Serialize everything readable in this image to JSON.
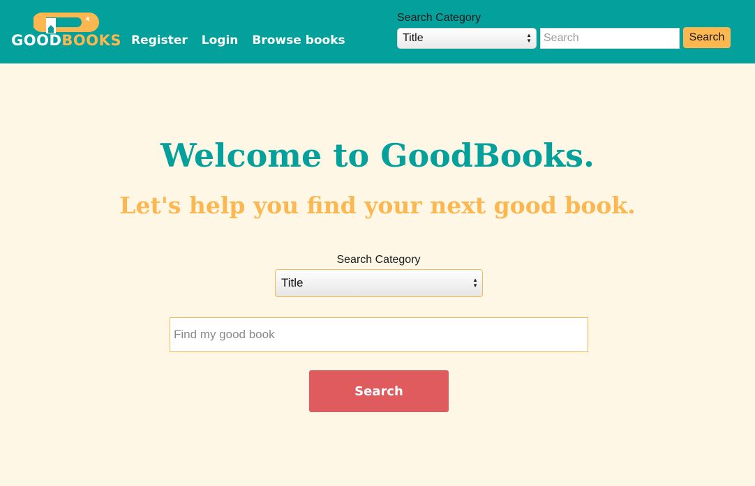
{
  "header": {
    "logo": {
      "word1": "GOOD",
      "word2": "BOOKS"
    },
    "nav": [
      {
        "label": "Register"
      },
      {
        "label": "Login"
      },
      {
        "label": "Browse books"
      }
    ],
    "search": {
      "label": "Search Category",
      "category_value": "Title",
      "placeholder": "Search",
      "button_label": "Search"
    }
  },
  "hero": {
    "title": "Welcome to GoodBooks.",
    "subtitle": "Let's help you find your next good book."
  },
  "main_search": {
    "label": "Search Category",
    "category_value": "Title",
    "placeholder": "Find my good book",
    "button_label": "Search"
  },
  "colors": {
    "primary": "#03a09c",
    "accent": "#fdb751",
    "button": "#e05b5e",
    "background": "#fff7e6"
  },
  "icons": [
    "book-logo-icon",
    "select-arrows-icon"
  ]
}
